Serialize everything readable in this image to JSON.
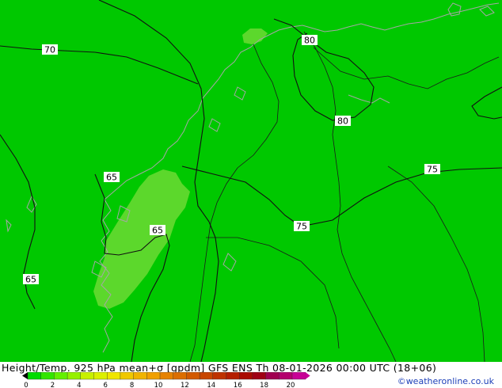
{
  "map": {
    "background_color": "#00c800",
    "contour_labels": {
      "west_70": "70",
      "north_80": "80",
      "northeast_80": "80",
      "east_75": "75",
      "central_75": "75",
      "midwest_65": "65",
      "center_65": "65",
      "southwest_65": "65"
    }
  },
  "footer": {
    "title": "Height/Temp. 925 hPa mean+σ [gpdm] GFS ENS  Th 08-01-2026 00:00 UTC (18+06)",
    "credit": "©weatheronline.co.uk",
    "colorbar": {
      "tick_labels": [
        "0",
        "2",
        "4",
        "6",
        "8",
        "10",
        "12",
        "14",
        "16",
        "18",
        "20"
      ],
      "colors": [
        "#00dc00",
        "#32e600",
        "#64f000",
        "#96f000",
        "#c8f000",
        "#dcf000",
        "#f0e600",
        "#f0c800",
        "#f0b400",
        "#f0a000",
        "#e68200",
        "#dc6e00",
        "#d25a00",
        "#c84600",
        "#be3200",
        "#b41e00",
        "#aa0a00",
        "#a00014",
        "#a00050",
        "#b4006e",
        "#c80096"
      ],
      "arrow_left_color": "#000000",
      "arrow_right_color": "#c80096"
    }
  }
}
